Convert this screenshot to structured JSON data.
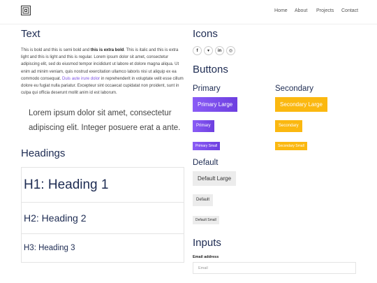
{
  "nav": {
    "items": [
      "Home",
      "About",
      "Projects",
      "Contact"
    ]
  },
  "text_section": {
    "title": "Text",
    "para_1": "This is bold and this is semi bold and ",
    "para_bold": "this is extra bold",
    "para_2": ". This is italic and this is extra light and this is light and this is regular. Lorem ipsum dolor sit amet, consectetur adipiscing elit, sed do eiusmod tempor incididunt ut labore et dolore magna aliqua. Ut enim ad minim veniam, quis nostrud exercitation ullamco laboris nisi ut aliquip ex ea commodo consequat. ",
    "para_link": "Duis aute irure dolor",
    "para_3": " in reprehenderit in voluptate velit esse cillum dolore eu fugiat nulla pariatur. Excepteur sint occaecat cupidatat non proident, sunt in culpa qui officia deserunt mollit anim id est laborum.",
    "lead": "Lorem ipsum dolor sit amet, consectetur adipiscing elit. Integer posuere erat a ante.",
    "link_color": "#7b4fe0"
  },
  "headings_section": {
    "title": "Headings",
    "h1": "H1: Heading 1",
    "h2": "H2: Heading 2",
    "h3": "H3: Heading 3"
  },
  "icons_section": {
    "title": "Icons",
    "icons": [
      {
        "name": "facebook-icon",
        "glyph": "f"
      },
      {
        "name": "twitter-icon",
        "glyph": "▾"
      },
      {
        "name": "linkedin-icon",
        "glyph": "in"
      },
      {
        "name": "instagram-icon",
        "glyph": "◎"
      }
    ]
  },
  "buttons_section": {
    "title": "Buttons",
    "primary": {
      "heading": "Primary",
      "large": "Primary Large",
      "medium": "Primary",
      "small": "Primary Small"
    },
    "secondary": {
      "heading": "Secondary",
      "large": "Secondary Large",
      "medium": "Secondary",
      "small": "Secondary Small"
    },
    "default": {
      "heading": "Default",
      "large": "Default Large",
      "medium": "Default",
      "small": "Default Small"
    },
    "colors": {
      "primary": "#7b4fe0",
      "secondary": "#fbb810",
      "default": "#ececec"
    }
  },
  "inputs_section": {
    "title": "Inputs",
    "email_label": "Email address",
    "email_placeholder": "Email"
  }
}
